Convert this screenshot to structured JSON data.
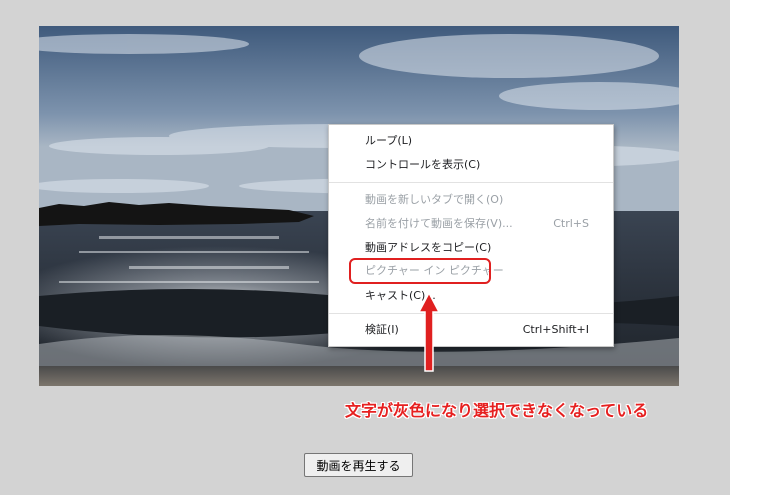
{
  "context_menu": {
    "items": [
      {
        "label": "ループ(L)",
        "shortcut": "",
        "enabled": true
      },
      {
        "label": "コントロールを表示(C)",
        "shortcut": "",
        "enabled": true
      },
      {
        "label": "動画を新しいタブで開く(O)",
        "shortcut": "",
        "enabled": false
      },
      {
        "label": "名前を付けて動画を保存(V)...",
        "shortcut": "Ctrl+S",
        "enabled": false
      },
      {
        "label": "動画アドレスをコピー(C)",
        "shortcut": "",
        "enabled": true
      },
      {
        "label": "ピクチャー イン ピクチャー",
        "shortcut": "",
        "enabled": false
      },
      {
        "label": "キャスト(C)...",
        "shortcut": "",
        "enabled": true
      },
      {
        "label": "検証(I)",
        "shortcut": "Ctrl+Shift+I",
        "enabled": true
      }
    ]
  },
  "annotation": {
    "text": "文字が灰色になり選択できなくなっている",
    "color": "#e62020"
  },
  "play_button": {
    "label": "動画を再生する"
  },
  "video": {
    "icon": "seaside-video-frame"
  },
  "colors": {
    "page_background": "#d3d3d3",
    "menu_background": "#ffffff",
    "menu_text": "#202124",
    "menu_disabled_text": "#9aa0a6",
    "highlight": "#e02020"
  }
}
